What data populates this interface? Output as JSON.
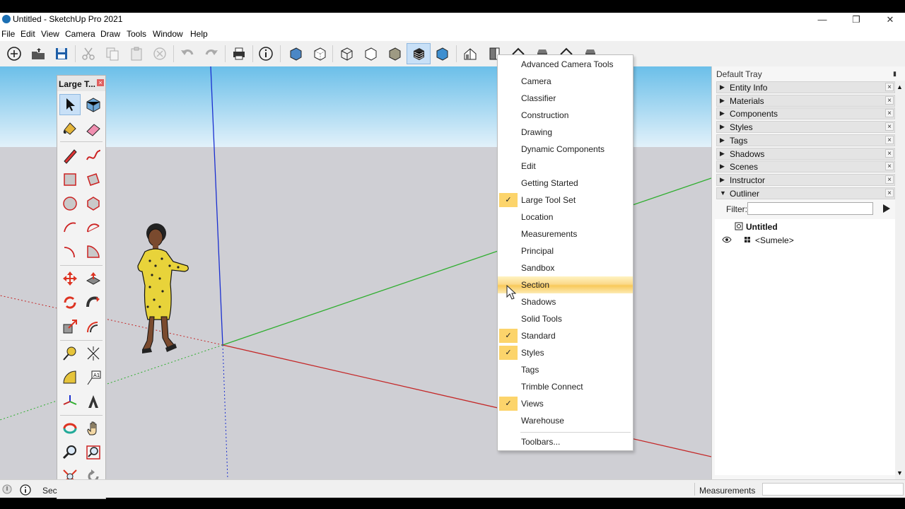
{
  "window": {
    "title": "Untitled - SketchUp Pro 2021"
  },
  "menubar": {
    "items": [
      "File",
      "Edit",
      "View",
      "Camera",
      "Draw",
      "Tools",
      "Window",
      "Help"
    ]
  },
  "palette": {
    "title": "Large T...",
    "close": "×"
  },
  "context_menu": {
    "items": [
      {
        "label": "Advanced Camera Tools",
        "checked": false
      },
      {
        "label": "Camera",
        "checked": false
      },
      {
        "label": "Classifier",
        "checked": false
      },
      {
        "label": "Construction",
        "checked": false
      },
      {
        "label": "Drawing",
        "checked": false
      },
      {
        "label": "Dynamic Components",
        "checked": false
      },
      {
        "label": "Edit",
        "checked": false
      },
      {
        "label": "Getting Started",
        "checked": false
      },
      {
        "label": "Large Tool Set",
        "checked": true
      },
      {
        "label": "Location",
        "checked": false
      },
      {
        "label": "Measurements",
        "checked": false
      },
      {
        "label": "Principal",
        "checked": false
      },
      {
        "label": "Sandbox",
        "checked": false
      },
      {
        "label": "Section",
        "checked": false,
        "hovered": true
      },
      {
        "label": "Shadows",
        "checked": false
      },
      {
        "label": "Solid Tools",
        "checked": false
      },
      {
        "label": "Standard",
        "checked": true
      },
      {
        "label": "Styles",
        "checked": true
      },
      {
        "label": "Tags",
        "checked": false
      },
      {
        "label": "Trimble Connect",
        "checked": false
      },
      {
        "label": "Views",
        "checked": true
      },
      {
        "label": "Warehouse",
        "checked": false
      }
    ],
    "footer_item": "Toolbars...",
    "check_mark": "✓"
  },
  "tray": {
    "title": "Default Tray",
    "panels": [
      {
        "label": "Entity Info",
        "expanded": false
      },
      {
        "label": "Materials",
        "expanded": false
      },
      {
        "label": "Components",
        "expanded": false
      },
      {
        "label": "Styles",
        "expanded": false
      },
      {
        "label": "Tags",
        "expanded": false
      },
      {
        "label": "Shadows",
        "expanded": false
      },
      {
        "label": "Scenes",
        "expanded": false
      },
      {
        "label": "Instructor",
        "expanded": false
      },
      {
        "label": "Outliner",
        "expanded": true
      }
    ],
    "close_glyph": "×",
    "collapsed_glyph": "▶",
    "expanded_glyph": "▼",
    "outliner": {
      "filter_label": "Filter:",
      "filter_value": "",
      "root": "Untitled",
      "child": "<Sumele>"
    }
  },
  "statusbar": {
    "text": "Sec",
    "measurements_label": "Measurements",
    "measurements_value": ""
  },
  "colors": {
    "sky_top": "#6bbfe9",
    "sky_bottom": "#e2f1fa",
    "ground": "#cfcfd4",
    "axis_blue": "#1a2fd0",
    "axis_green": "#2fae2f",
    "axis_red": "#c42828",
    "check_bg": "#fcd46b"
  }
}
